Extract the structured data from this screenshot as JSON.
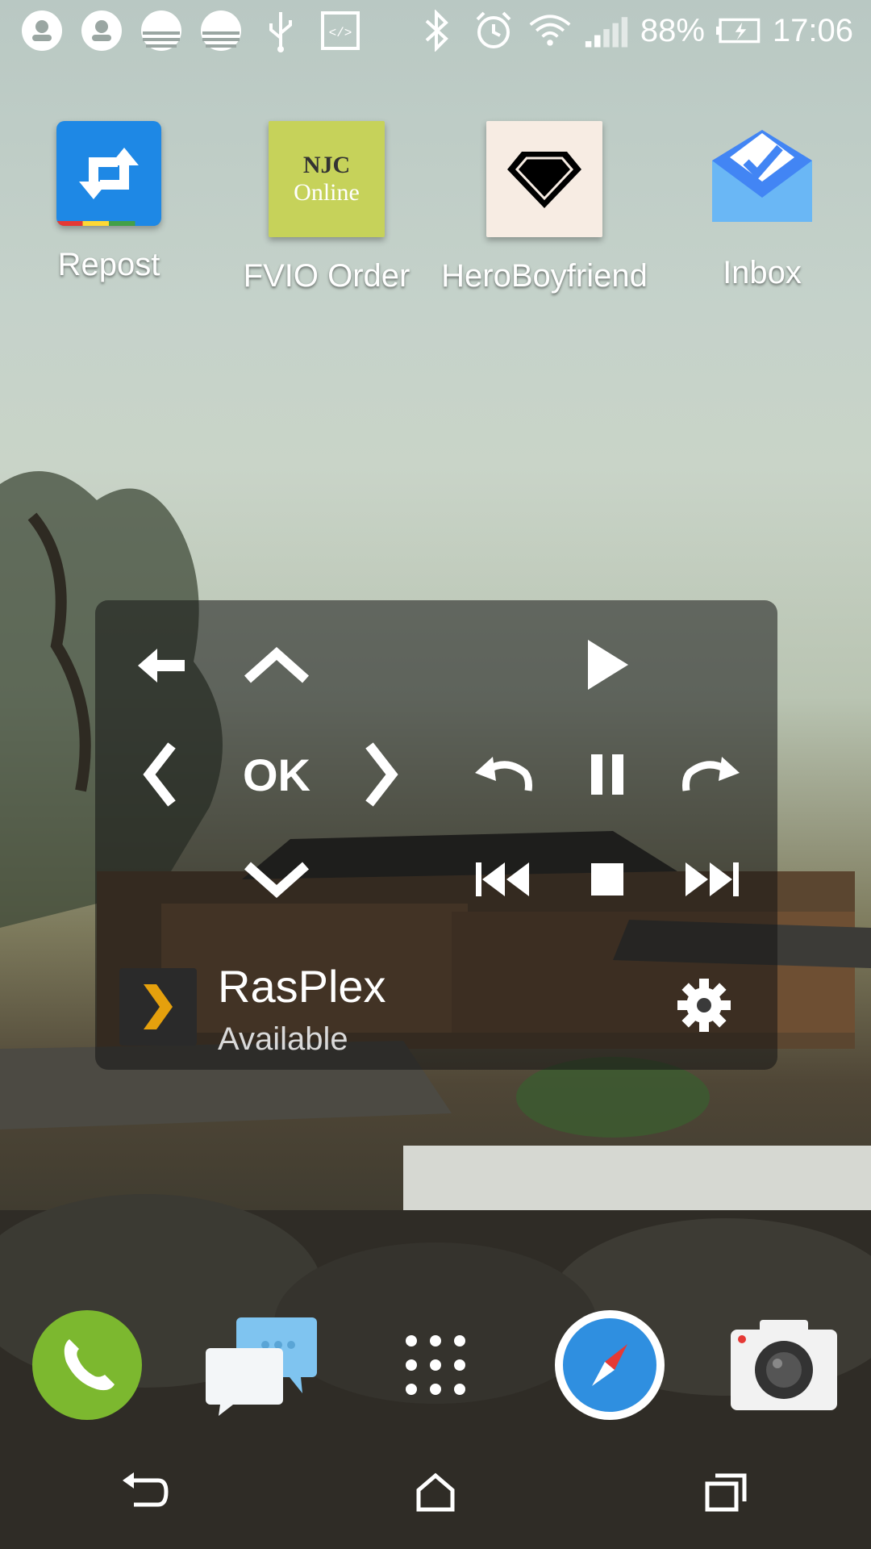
{
  "status_bar": {
    "battery": "88%",
    "time": "17:06",
    "icons": [
      "notification-icon",
      "notification-icon",
      "notification-icon",
      "notification-icon",
      "usb-icon",
      "developer-icon",
      "bluetooth-icon",
      "alarm-icon",
      "wifi-icon",
      "signal-icon",
      "battery-charging-icon"
    ]
  },
  "apps": [
    {
      "label": "Repost",
      "icon": "repost-icon"
    },
    {
      "label": "FVIO Order",
      "icon": "njc-online-icon",
      "icon_text_line1": "NJC",
      "icon_text_line2": "Online"
    },
    {
      "label": "HeroBoyfriend",
      "icon": "diamond-icon"
    },
    {
      "label": "Inbox",
      "icon": "inbox-icon"
    }
  ],
  "remote": {
    "ok_label": "OK",
    "server_name": "RasPlex",
    "server_status": "Available"
  },
  "dock": [
    {
      "name": "phone",
      "icon": "phone-icon"
    },
    {
      "name": "messages",
      "icon": "messages-icon"
    },
    {
      "name": "app-drawer",
      "icon": "app-drawer-icon"
    },
    {
      "name": "browser",
      "icon": "compass-icon"
    },
    {
      "name": "camera",
      "icon": "camera-icon"
    }
  ],
  "colors": {
    "repost_blue": "#1e88e5",
    "njc_green": "#c6d25a",
    "phone_green": "#7cb82f",
    "plex_orange": "#e5a00d"
  }
}
